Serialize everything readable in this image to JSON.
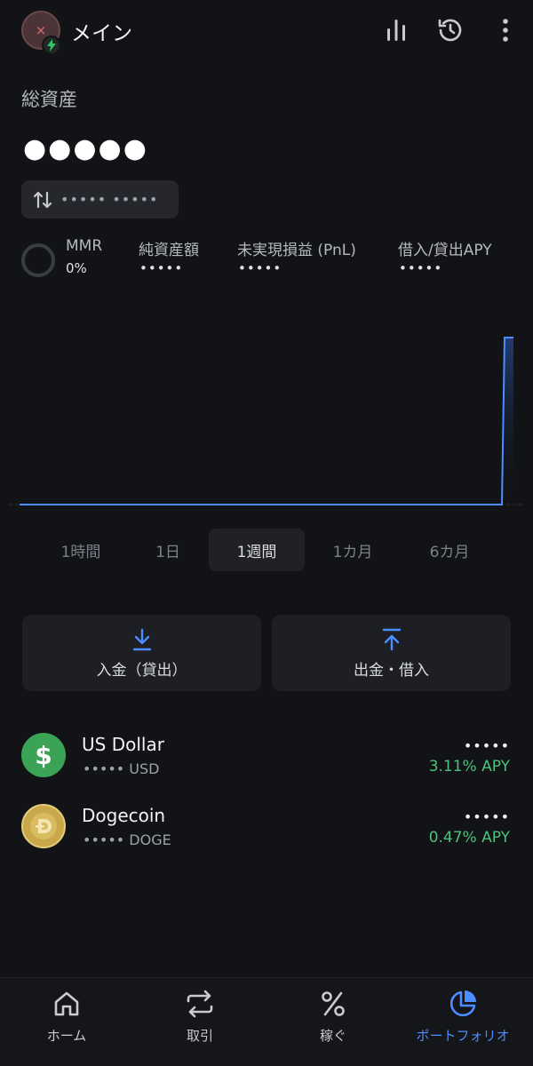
{
  "header": {
    "title": "メイン",
    "icons": [
      "stats-icon",
      "history-icon",
      "more-icon"
    ]
  },
  "portfolio": {
    "total_label": "総資産",
    "total_value": "●●●●●",
    "change_text": "••••• •••••",
    "stats": [
      {
        "label": "MMR",
        "value": "0%"
      },
      {
        "label": "純資産額",
        "value": "•••••"
      },
      {
        "label": "未実現損益 (PnL)",
        "value": "•••••"
      },
      {
        "label": "借入/貸出APY",
        "value": "•••••"
      }
    ]
  },
  "chart_data": {
    "type": "area",
    "line_color": "#4c8dff",
    "values": [
      0,
      0,
      0,
      0,
      0,
      0,
      0,
      0,
      0,
      0,
      0,
      0,
      1
    ]
  },
  "ranges": {
    "items": [
      "1時間",
      "1日",
      "1週間",
      "1カ月",
      "6カ月"
    ],
    "selected": "1週間"
  },
  "actions": {
    "deposit_label": "入金（貸出）",
    "withdraw_label": "出金・借入"
  },
  "assets": [
    {
      "name": "US Dollar",
      "amount": "••••• USD",
      "value": "•••••",
      "apy": "3.11% APY",
      "icon": "dollar-icon",
      "color": "#3aa356"
    },
    {
      "name": "Dogecoin",
      "amount": "••••• DOGE",
      "value": "•••••",
      "apy": "0.47% APY",
      "icon": "dogecoin-icon",
      "color": "#c8a84a"
    }
  ],
  "nav": {
    "items": [
      {
        "label": "ホーム",
        "icon": "home-icon"
      },
      {
        "label": "取引",
        "icon": "swap-icon"
      },
      {
        "label": "稼ぐ",
        "icon": "percent-icon"
      },
      {
        "label": "ポートフォリオ",
        "icon": "pie-chart-icon"
      }
    ],
    "active": "ポートフォリオ",
    "active_color": "#4c8dff"
  }
}
